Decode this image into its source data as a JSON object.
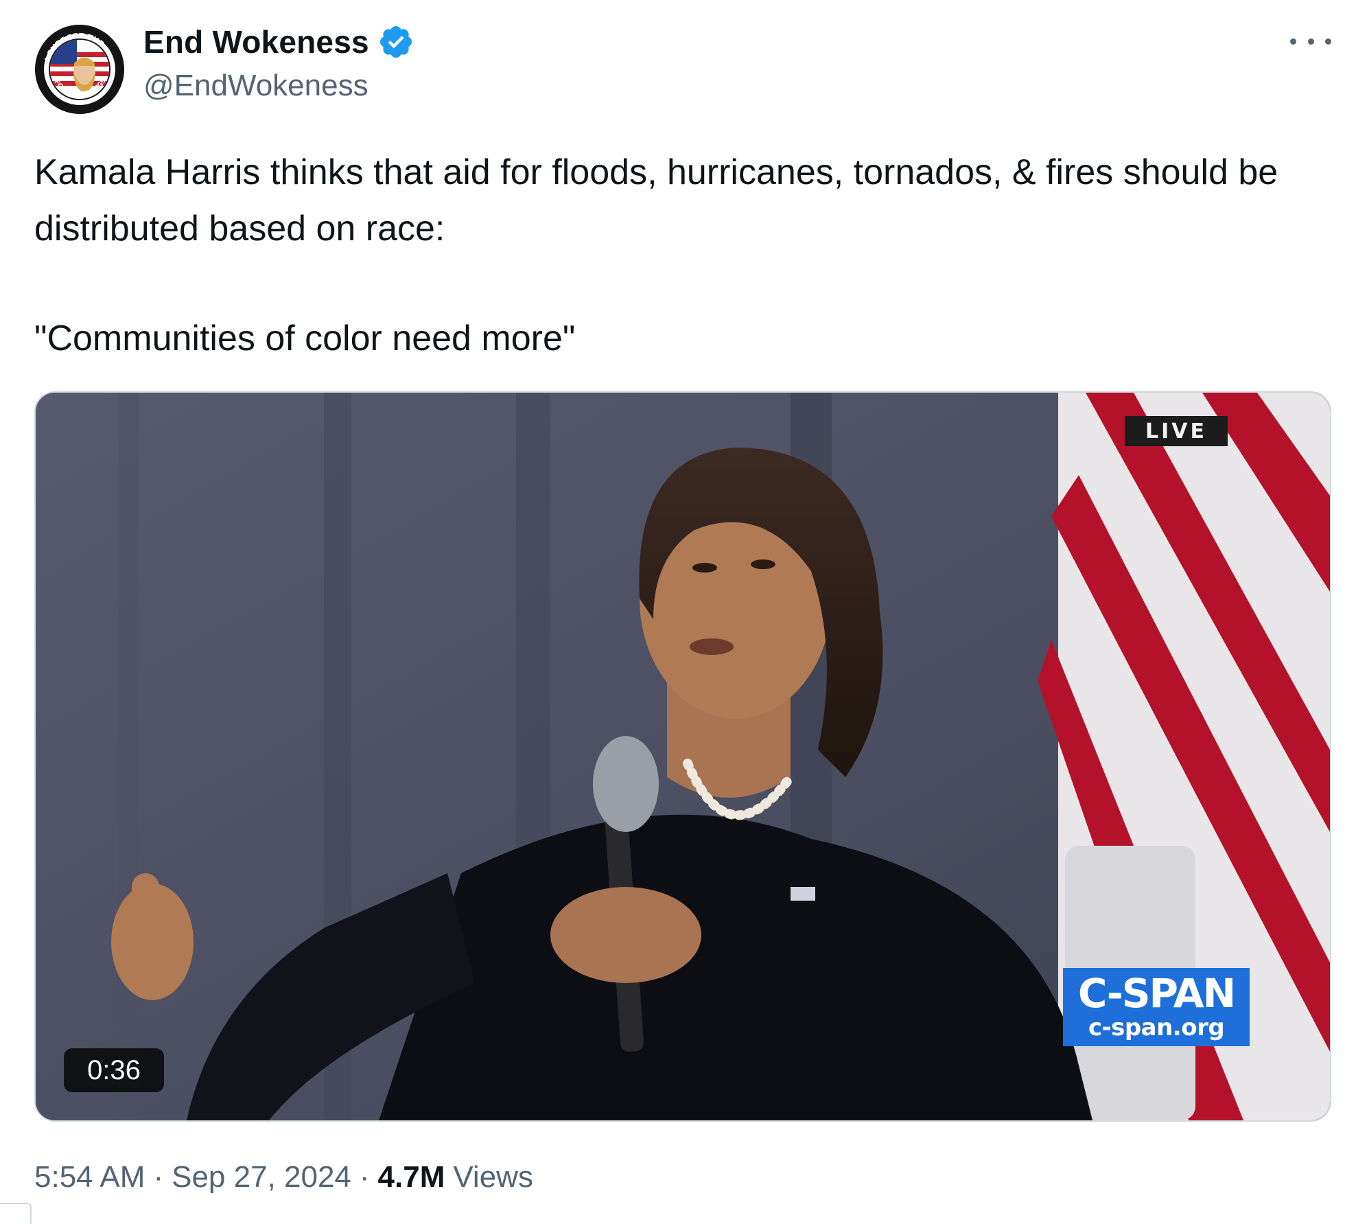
{
  "author": {
    "display_name": "End Wokeness",
    "handle": "@EndWokeness",
    "avatar_text_top": "I SUPPORT THE",
    "avatar_text_bottom": "FORMER THINGS",
    "verified": true,
    "verified_color": "#1d9bf0"
  },
  "more_icon": "more-horizontal-icon",
  "tweet": {
    "line1": "Kamala Harris thinks that aid for floods, hurricanes, tornados, & fires should be distributed based on race:",
    "line2": "\"Communities of color need more\""
  },
  "media": {
    "type": "video",
    "live_label": "LIVE",
    "network_logo": "C-SPAN",
    "network_url": "c-span.org",
    "duration": "0:36"
  },
  "meta": {
    "time": "5:54 AM",
    "date": "Sep 27, 2024",
    "views_count": "4.7M",
    "views_label": "Views"
  }
}
